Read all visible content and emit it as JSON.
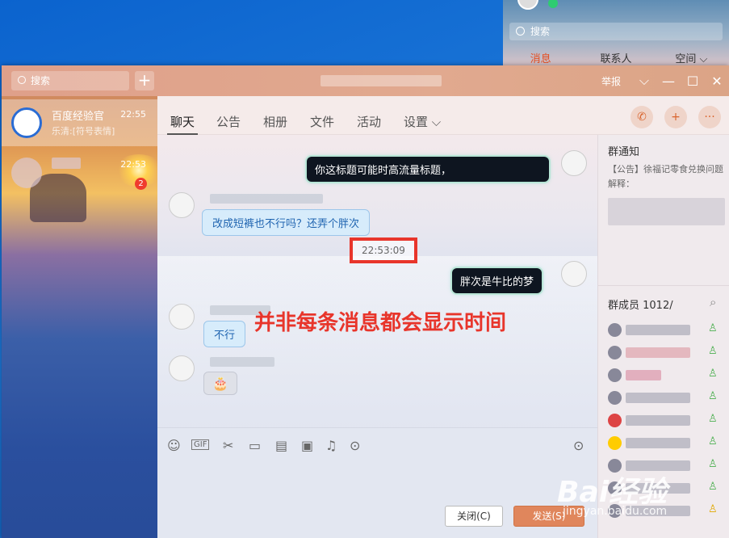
{
  "background_window": {
    "search_placeholder": "搜索",
    "tabs": [
      "消息",
      "联系人",
      "空间 ⌵"
    ]
  },
  "titlebar": {
    "search_placeholder": "搜索",
    "add_label": "+",
    "report_label": "举报",
    "chevron": "⌵",
    "minimize": "—",
    "maximize": "☐",
    "close": "✕"
  },
  "sidebar": {
    "conversations": [
      {
        "name": "百度经验官",
        "preview": "乐清:[符号表情]",
        "time": "22:55"
      },
      {
        "name": "",
        "preview": "",
        "time": "22:53",
        "badge": "2"
      }
    ]
  },
  "nav": {
    "tabs": [
      "聊天",
      "公告",
      "相册",
      "文件",
      "活动",
      "设置 ⌵"
    ],
    "phone_icon": "✆",
    "add_icon": "+",
    "more_icon": "···"
  },
  "chat": {
    "msg1": "你这标题可能时高流量标题，",
    "msg2": "改成短裤也不行吗？还弄个胖次",
    "timestamp": "22:53:09",
    "msg3": "胖次是牛比的梦",
    "msg4": "不行",
    "msg5": "🎂",
    "annotation": "并非每条消息都会显示时间"
  },
  "toolbar": {
    "icons": [
      "☺",
      "GIF",
      "✂",
      "▭",
      "▤",
      "▣",
      "♫",
      "⊙",
      "⊙"
    ]
  },
  "buttons": {
    "close": "关闭(C)",
    "send": "发送(S)"
  },
  "panel": {
    "notice_title": "群通知",
    "notice_text": "【公告】徐福记零食兑换问题解释：",
    "members_title": "群成员 1012/",
    "search_icon": "⌕"
  },
  "watermark": {
    "logo": "Bai经验",
    "url": "jingyan.baidu.com"
  }
}
